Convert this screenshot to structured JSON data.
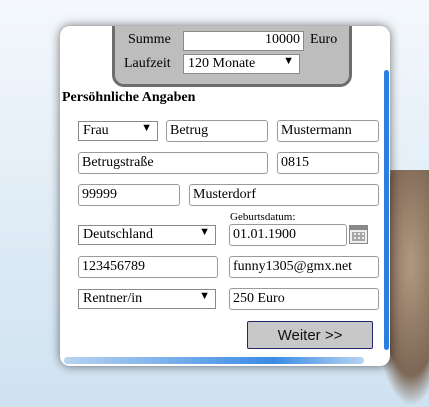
{
  "summary": {
    "summe_label": "Summe",
    "summe_value": "10000",
    "currency": "Euro",
    "laufzeit_label": "Laufzeit",
    "laufzeit_value": "120 Monate"
  },
  "section_title": "Persöhnliche Angaben",
  "form": {
    "anrede": "Frau",
    "vorname": "Betrug",
    "nachname": "Mustermann",
    "strasse": "Betrugstraße",
    "hausnummer": "0815",
    "plz": "99999",
    "ort": "Musterdorf",
    "land": "Deutschland",
    "geburtsdatum_label": "Geburtsdatum:",
    "geburtsdatum": "01.01.1900",
    "telefon": "123456789",
    "email": "funny1305@gmx.net",
    "beruf": "Rentner/in",
    "einkommen": "250 Euro"
  },
  "button": {
    "weiter": "Weiter >>"
  },
  "icons": {
    "calendar": "calendar-icon",
    "dropdown": "chevron-down-icon"
  },
  "colors": {
    "accent": "#2c7fe0",
    "button_border": "#22256b",
    "summary_bg": "#bdbdbd"
  }
}
